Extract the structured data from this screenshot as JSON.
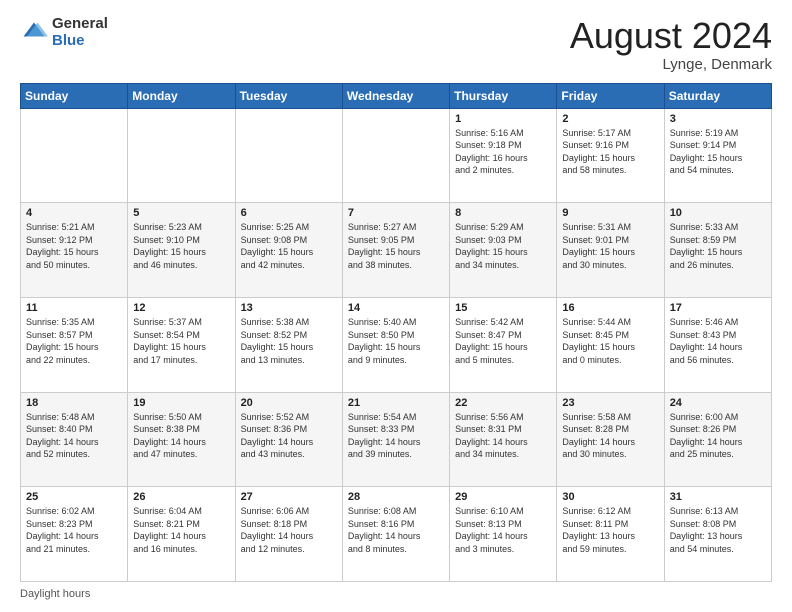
{
  "logo": {
    "general": "General",
    "blue": "Blue"
  },
  "title": "August 2024",
  "subtitle": "Lynge, Denmark",
  "days_of_week": [
    "Sunday",
    "Monday",
    "Tuesday",
    "Wednesday",
    "Thursday",
    "Friday",
    "Saturday"
  ],
  "footer": "Daylight hours",
  "weeks": [
    [
      {
        "num": "",
        "info": ""
      },
      {
        "num": "",
        "info": ""
      },
      {
        "num": "",
        "info": ""
      },
      {
        "num": "",
        "info": ""
      },
      {
        "num": "1",
        "info": "Sunrise: 5:16 AM\nSunset: 9:18 PM\nDaylight: 16 hours\nand 2 minutes."
      },
      {
        "num": "2",
        "info": "Sunrise: 5:17 AM\nSunset: 9:16 PM\nDaylight: 15 hours\nand 58 minutes."
      },
      {
        "num": "3",
        "info": "Sunrise: 5:19 AM\nSunset: 9:14 PM\nDaylight: 15 hours\nand 54 minutes."
      }
    ],
    [
      {
        "num": "4",
        "info": "Sunrise: 5:21 AM\nSunset: 9:12 PM\nDaylight: 15 hours\nand 50 minutes."
      },
      {
        "num": "5",
        "info": "Sunrise: 5:23 AM\nSunset: 9:10 PM\nDaylight: 15 hours\nand 46 minutes."
      },
      {
        "num": "6",
        "info": "Sunrise: 5:25 AM\nSunset: 9:08 PM\nDaylight: 15 hours\nand 42 minutes."
      },
      {
        "num": "7",
        "info": "Sunrise: 5:27 AM\nSunset: 9:05 PM\nDaylight: 15 hours\nand 38 minutes."
      },
      {
        "num": "8",
        "info": "Sunrise: 5:29 AM\nSunset: 9:03 PM\nDaylight: 15 hours\nand 34 minutes."
      },
      {
        "num": "9",
        "info": "Sunrise: 5:31 AM\nSunset: 9:01 PM\nDaylight: 15 hours\nand 30 minutes."
      },
      {
        "num": "10",
        "info": "Sunrise: 5:33 AM\nSunset: 8:59 PM\nDaylight: 15 hours\nand 26 minutes."
      }
    ],
    [
      {
        "num": "11",
        "info": "Sunrise: 5:35 AM\nSunset: 8:57 PM\nDaylight: 15 hours\nand 22 minutes."
      },
      {
        "num": "12",
        "info": "Sunrise: 5:37 AM\nSunset: 8:54 PM\nDaylight: 15 hours\nand 17 minutes."
      },
      {
        "num": "13",
        "info": "Sunrise: 5:38 AM\nSunset: 8:52 PM\nDaylight: 15 hours\nand 13 minutes."
      },
      {
        "num": "14",
        "info": "Sunrise: 5:40 AM\nSunset: 8:50 PM\nDaylight: 15 hours\nand 9 minutes."
      },
      {
        "num": "15",
        "info": "Sunrise: 5:42 AM\nSunset: 8:47 PM\nDaylight: 15 hours\nand 5 minutes."
      },
      {
        "num": "16",
        "info": "Sunrise: 5:44 AM\nSunset: 8:45 PM\nDaylight: 15 hours\nand 0 minutes."
      },
      {
        "num": "17",
        "info": "Sunrise: 5:46 AM\nSunset: 8:43 PM\nDaylight: 14 hours\nand 56 minutes."
      }
    ],
    [
      {
        "num": "18",
        "info": "Sunrise: 5:48 AM\nSunset: 8:40 PM\nDaylight: 14 hours\nand 52 minutes."
      },
      {
        "num": "19",
        "info": "Sunrise: 5:50 AM\nSunset: 8:38 PM\nDaylight: 14 hours\nand 47 minutes."
      },
      {
        "num": "20",
        "info": "Sunrise: 5:52 AM\nSunset: 8:36 PM\nDaylight: 14 hours\nand 43 minutes."
      },
      {
        "num": "21",
        "info": "Sunrise: 5:54 AM\nSunset: 8:33 PM\nDaylight: 14 hours\nand 39 minutes."
      },
      {
        "num": "22",
        "info": "Sunrise: 5:56 AM\nSunset: 8:31 PM\nDaylight: 14 hours\nand 34 minutes."
      },
      {
        "num": "23",
        "info": "Sunrise: 5:58 AM\nSunset: 8:28 PM\nDaylight: 14 hours\nand 30 minutes."
      },
      {
        "num": "24",
        "info": "Sunrise: 6:00 AM\nSunset: 8:26 PM\nDaylight: 14 hours\nand 25 minutes."
      }
    ],
    [
      {
        "num": "25",
        "info": "Sunrise: 6:02 AM\nSunset: 8:23 PM\nDaylight: 14 hours\nand 21 minutes."
      },
      {
        "num": "26",
        "info": "Sunrise: 6:04 AM\nSunset: 8:21 PM\nDaylight: 14 hours\nand 16 minutes."
      },
      {
        "num": "27",
        "info": "Sunrise: 6:06 AM\nSunset: 8:18 PM\nDaylight: 14 hours\nand 12 minutes."
      },
      {
        "num": "28",
        "info": "Sunrise: 6:08 AM\nSunset: 8:16 PM\nDaylight: 14 hours\nand 8 minutes."
      },
      {
        "num": "29",
        "info": "Sunrise: 6:10 AM\nSunset: 8:13 PM\nDaylight: 14 hours\nand 3 minutes."
      },
      {
        "num": "30",
        "info": "Sunrise: 6:12 AM\nSunset: 8:11 PM\nDaylight: 13 hours\nand 59 minutes."
      },
      {
        "num": "31",
        "info": "Sunrise: 6:13 AM\nSunset: 8:08 PM\nDaylight: 13 hours\nand 54 minutes."
      }
    ]
  ]
}
